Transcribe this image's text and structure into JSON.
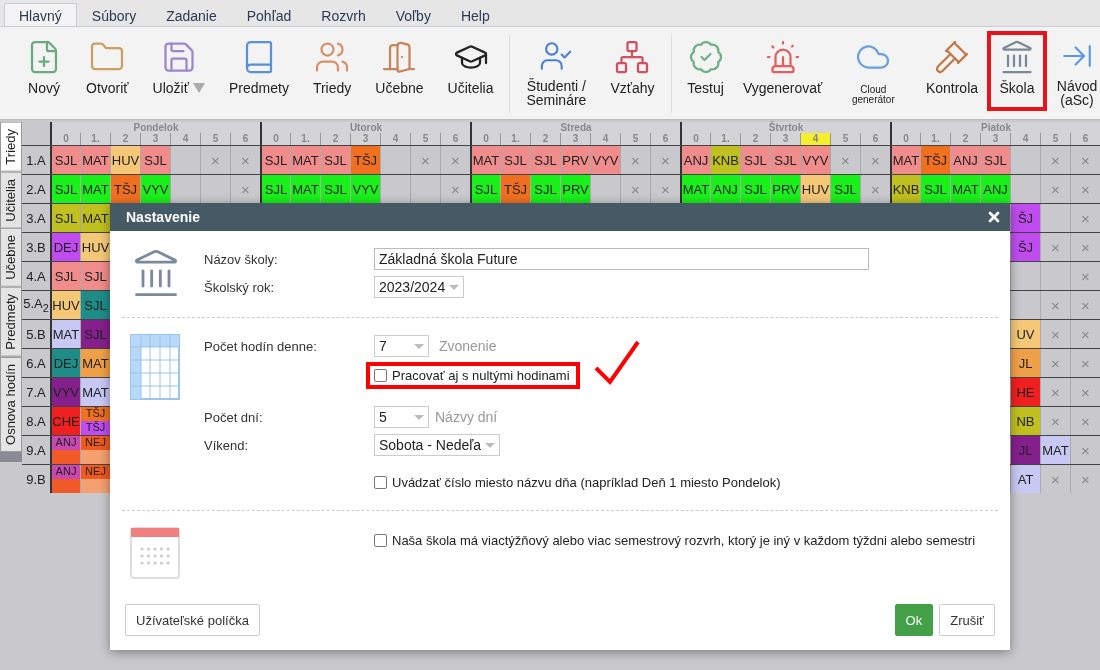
{
  "menu": {
    "tabs": [
      {
        "label": "Hlavný",
        "selected": true
      },
      {
        "label": "Súbory",
        "selected": false
      },
      {
        "label": "Zadanie",
        "selected": false
      },
      {
        "label": "Pohľad",
        "selected": false
      },
      {
        "label": "Rozvrh",
        "selected": false
      },
      {
        "label": "Voľby",
        "selected": false
      },
      {
        "label": "Help",
        "selected": false
      }
    ]
  },
  "toolbar": {
    "groups": [
      {
        "buttons": [
          {
            "label": "Nový",
            "kind": "normal",
            "highlighted": false
          },
          {
            "label": "Otvoriť",
            "kind": "normal",
            "highlighted": false
          },
          {
            "label": "Uložiť",
            "kind": "dropdown",
            "highlighted": false
          },
          {
            "label": "Predmety",
            "kind": "normal",
            "highlighted": false
          },
          {
            "label": "Triedy",
            "kind": "normal",
            "highlighted": false
          },
          {
            "label": "Učebne",
            "kind": "normal",
            "highlighted": false
          },
          {
            "label": "Učitelia",
            "kind": "normal",
            "highlighted": false
          }
        ]
      },
      {
        "buttons": [
          {
            "label": "Študenti /\nSemináre",
            "kind": "normal",
            "highlighted": false
          },
          {
            "label": "Vzťahy",
            "kind": "normal",
            "highlighted": false
          }
        ]
      },
      {
        "buttons": [
          {
            "label": "Testuj",
            "kind": "normal",
            "highlighted": false
          },
          {
            "label": "Vygenerovať",
            "kind": "normal",
            "highlighted": false
          },
          {
            "label": "Cloud generátor",
            "kind": "compact",
            "highlighted": false
          },
          {
            "label": "Kontrola",
            "kind": "normal",
            "highlighted": false
          },
          {
            "label": "Škola",
            "kind": "normal",
            "highlighted": true
          },
          {
            "label": "Návod\n(aSc)",
            "kind": "normal",
            "highlighted": false
          }
        ]
      }
    ]
  },
  "side_tabs": [
    {
      "label": "Triedy",
      "selected": true
    },
    {
      "label": "Učitelia",
      "selected": false
    },
    {
      "label": "Učebne",
      "selected": false
    },
    {
      "label": "Predmety",
      "selected": false
    },
    {
      "label": "Osnova hodín",
      "selected": false
    }
  ],
  "timetable": {
    "days": [
      {
        "name": "Pondelok",
        "periods": [
          {
            "label": "0",
            "highlighted": false
          },
          {
            "label": "1.",
            "highlighted": false
          },
          {
            "label": "2",
            "highlighted": false
          },
          {
            "label": "3",
            "highlighted": false
          },
          {
            "label": "4",
            "highlighted": false
          },
          {
            "label": "5",
            "highlighted": false
          },
          {
            "label": "6",
            "highlighted": false
          }
        ]
      },
      {
        "name": "Utorok",
        "periods": [
          {
            "label": "0",
            "highlighted": false
          },
          {
            "label": "1.",
            "highlighted": false
          },
          {
            "label": "2",
            "highlighted": false
          },
          {
            "label": "3",
            "highlighted": false
          },
          {
            "label": "4",
            "highlighted": false
          },
          {
            "label": "5",
            "highlighted": false
          },
          {
            "label": "6",
            "highlighted": false
          }
        ]
      },
      {
        "name": "Streda",
        "periods": [
          {
            "label": "0",
            "highlighted": false
          },
          {
            "label": "1.",
            "highlighted": false
          },
          {
            "label": "2",
            "highlighted": false
          },
          {
            "label": "3",
            "highlighted": false
          },
          {
            "label": "4",
            "highlighted": false
          },
          {
            "label": "5",
            "highlighted": false
          },
          {
            "label": "6",
            "highlighted": false
          }
        ]
      },
      {
        "name": "Štvrtok",
        "periods": [
          {
            "label": "0",
            "highlighted": false
          },
          {
            "label": "1.",
            "highlighted": false
          },
          {
            "label": "2",
            "highlighted": false
          },
          {
            "label": "3",
            "highlighted": false
          },
          {
            "label": "4",
            "highlighted": true
          },
          {
            "label": "5",
            "highlighted": false
          },
          {
            "label": "6",
            "highlighted": false
          }
        ]
      },
      {
        "name": "Piatok",
        "periods": [
          {
            "label": "0",
            "highlighted": false
          },
          {
            "label": "1.",
            "highlighted": false
          },
          {
            "label": "2",
            "highlighted": false
          },
          {
            "label": "3",
            "highlighted": false
          },
          {
            "label": "4",
            "highlighted": false
          },
          {
            "label": "5",
            "highlighted": false
          },
          {
            "label": "6",
            "highlighted": false
          }
        ]
      }
    ],
    "rows": [
      {
        "name": "1.A",
        "kind": "full",
        "cells": [
          {
            "kind": "lesson",
            "text": "SJL",
            "color": "#f08c8c"
          },
          {
            "kind": "lesson",
            "text": "MAT",
            "color": "#f08c8c"
          },
          {
            "kind": "lesson",
            "text": "HUV",
            "color": "#f5c878"
          },
          {
            "kind": "lesson",
            "text": "SJL",
            "color": "#f08c8c"
          },
          {
            "kind": "empty"
          },
          {
            "kind": "blocked",
            "text": "×"
          },
          {
            "kind": "blocked",
            "text": "×"
          },
          {
            "kind": "lesson",
            "text": "SJL",
            "color": "#f08c8c"
          },
          {
            "kind": "lesson",
            "text": "MAT",
            "color": "#f08c8c"
          },
          {
            "kind": "lesson",
            "text": "SJL",
            "color": "#f08c8c"
          },
          {
            "kind": "lesson",
            "text": "TŠJ",
            "color": "#f07020"
          },
          {
            "kind": "empty"
          },
          {
            "kind": "blocked",
            "text": "×"
          },
          {
            "kind": "blocked",
            "text": "×"
          },
          {
            "kind": "lesson",
            "text": "MAT",
            "color": "#f08c8c"
          },
          {
            "kind": "lesson",
            "text": "SJL",
            "color": "#f08c8c"
          },
          {
            "kind": "lesson",
            "text": "SJL",
            "color": "#f08c8c"
          },
          {
            "kind": "lesson",
            "text": "PRV",
            "color": "#f08c8c"
          },
          {
            "kind": "lesson",
            "text": "VYV",
            "color": "#f08c8c"
          },
          {
            "kind": "blocked",
            "text": "×"
          },
          {
            "kind": "blocked",
            "text": "×"
          },
          {
            "kind": "lesson",
            "text": "ANJ",
            "color": "#f08c8c"
          },
          {
            "kind": "lesson",
            "text": "KNB",
            "color": "#c0c020"
          },
          {
            "kind": "lesson",
            "text": "SJL",
            "color": "#f08c8c"
          },
          {
            "kind": "lesson",
            "text": "SJL",
            "color": "#f08c8c"
          },
          {
            "kind": "lesson",
            "text": "VYV",
            "color": "#f08c8c"
          },
          {
            "kind": "blocked",
            "text": "×"
          },
          {
            "kind": "blocked",
            "text": "×"
          },
          {
            "kind": "lesson",
            "text": "MAT",
            "color": "#f08c8c"
          },
          {
            "kind": "lesson",
            "text": "TŠJ",
            "color": "#f07020"
          },
          {
            "kind": "lesson",
            "text": "ANJ",
            "color": "#f08c8c"
          },
          {
            "kind": "lesson",
            "text": "SJL",
            "color": "#f08c8c"
          },
          {
            "kind": "empty"
          },
          {
            "kind": "blocked",
            "text": "×"
          },
          {
            "kind": "blocked",
            "text": "×"
          }
        ]
      },
      {
        "name": "2.A",
        "kind": "full",
        "cells": [
          {
            "kind": "lesson",
            "text": "SJL",
            "color": "#1af01a"
          },
          {
            "kind": "lesson",
            "text": "MAT",
            "color": "#1af01a"
          },
          {
            "kind": "lesson",
            "text": "TŠJ",
            "color": "#f07020"
          },
          {
            "kind": "lesson",
            "text": "VYV",
            "color": "#1af01a"
          },
          {
            "kind": "empty"
          },
          {
            "kind": "empty"
          },
          {
            "kind": "blocked",
            "text": "×"
          },
          {
            "kind": "lesson",
            "text": "SJL",
            "color": "#1af01a"
          },
          {
            "kind": "lesson",
            "text": "MAT",
            "color": "#1af01a"
          },
          {
            "kind": "lesson",
            "text": "SJL",
            "color": "#1af01a"
          },
          {
            "kind": "lesson",
            "text": "VYV",
            "color": "#1af01a"
          },
          {
            "kind": "empty"
          },
          {
            "kind": "empty"
          },
          {
            "kind": "blocked",
            "text": "×"
          },
          {
            "kind": "lesson",
            "text": "SJL",
            "color": "#1af01a"
          },
          {
            "kind": "lesson",
            "text": "TŠJ",
            "color": "#f07020"
          },
          {
            "kind": "lesson",
            "text": "SJL",
            "color": "#1af01a"
          },
          {
            "kind": "lesson",
            "text": "PRV",
            "color": "#1af01a"
          },
          {
            "kind": "empty"
          },
          {
            "kind": "blocked",
            "text": "×"
          },
          {
            "kind": "blocked",
            "text": "×"
          },
          {
            "kind": "lesson",
            "text": "MAT",
            "color": "#1af01a"
          },
          {
            "kind": "lesson",
            "text": "ANJ",
            "color": "#1af01a"
          },
          {
            "kind": "lesson",
            "text": "SJL",
            "color": "#1af01a"
          },
          {
            "kind": "lesson",
            "text": "PRV",
            "color": "#1af01a"
          },
          {
            "kind": "lesson",
            "text": "HUV",
            "color": "#f5c878"
          },
          {
            "kind": "lesson",
            "text": "SJL",
            "color": "#1af01a"
          },
          {
            "kind": "blocked",
            "text": "×"
          },
          {
            "kind": "lesson",
            "text": "KNB",
            "color": "#c0c020"
          },
          {
            "kind": "lesson",
            "text": "SJL",
            "color": "#1af01a"
          },
          {
            "kind": "lesson",
            "text": "MAT",
            "color": "#1af01a"
          },
          {
            "kind": "lesson",
            "text": "ANJ",
            "color": "#1af01a"
          },
          {
            "kind": "empty"
          },
          {
            "kind": "blocked",
            "text": "×"
          },
          {
            "kind": "blocked",
            "text": "×"
          }
        ]
      },
      {
        "name": "3.A",
        "kind": "covered",
        "left": [
          {
            "kind": "lesson",
            "text": "SJL",
            "color": "#c0c020"
          },
          {
            "kind": "lesson",
            "text": "MAT",
            "color": "#c0c020"
          }
        ],
        "right": [
          {
            "kind": "lesson",
            "text": "ŠJ",
            "color": "#c04cf0"
          },
          {
            "kind": "empty"
          },
          {
            "kind": "blocked",
            "text": "×"
          }
        ]
      },
      {
        "name": "3.B",
        "kind": "covered",
        "left": [
          {
            "kind": "lesson",
            "text": "DEJ",
            "color": "#c04cf0"
          },
          {
            "kind": "lesson",
            "text": "HUV",
            "color": "#f5c878"
          }
        ],
        "right": [
          {
            "kind": "lesson",
            "text": "ŠJ",
            "color": "#c04cf0"
          },
          {
            "kind": "blocked",
            "text": "×"
          },
          {
            "kind": "blocked",
            "text": "×"
          }
        ]
      },
      {
        "name": "4.A",
        "kind": "covered",
        "left": [
          {
            "kind": "lesson",
            "text": "SJL",
            "color": "#f08c8c"
          },
          {
            "kind": "lesson",
            "text": "SJL",
            "color": "#f08c8c"
          }
        ],
        "right": [
          {
            "kind": "empty"
          },
          {
            "kind": "empty"
          },
          {
            "kind": "blocked",
            "text": "×"
          }
        ]
      },
      {
        "name": "5.A$_{2}$",
        "kind": "covered",
        "left": [
          {
            "kind": "lesson",
            "text": "HUV",
            "color": "#f5c878"
          },
          {
            "kind": "lesson",
            "text": "SJL",
            "color": "#208c88"
          }
        ],
        "right": [
          {
            "kind": "empty"
          },
          {
            "kind": "blocked",
            "text": "×"
          },
          {
            "kind": "blocked",
            "text": "×"
          }
        ]
      },
      {
        "name": "5.B",
        "kind": "covered",
        "left": [
          {
            "kind": "lesson",
            "text": "MAT",
            "color": "#c8c8f4"
          },
          {
            "kind": "lesson",
            "text": "SJL",
            "color": "#84208c"
          }
        ],
        "right": [
          {
            "kind": "lesson",
            "text": "UV",
            "color": "#f5c878"
          },
          {
            "kind": "blocked",
            "text": "×"
          },
          {
            "kind": "blocked",
            "text": "×"
          }
        ]
      },
      {
        "name": "6.A",
        "kind": "covered",
        "left": [
          {
            "kind": "lesson",
            "text": "DEJ",
            "color": "#208c88"
          },
          {
            "kind": "lesson",
            "text": "MAT",
            "color": "#f0a048"
          }
        ],
        "right": [
          {
            "kind": "lesson",
            "text": "JL",
            "color": "#f0a048"
          },
          {
            "kind": "blocked",
            "text": "×"
          },
          {
            "kind": "blocked",
            "text": "×"
          }
        ]
      },
      {
        "name": "7.A",
        "kind": "covered",
        "left": [
          {
            "kind": "lesson",
            "text": "VYV",
            "color": "#84208c"
          },
          {
            "kind": "lesson",
            "text": "MAT",
            "color": "#c8c8f4"
          }
        ],
        "right": [
          {
            "kind": "lesson",
            "text": "HE",
            "color": "#f02020"
          },
          {
            "kind": "blocked",
            "text": "×"
          },
          {
            "kind": "blocked",
            "text": "×"
          }
        ]
      },
      {
        "name": "8.A",
        "kind": "covered",
        "left": [
          {
            "kind": "lesson",
            "text": "CHE",
            "color": "#f02020"
          },
          {
            "kind": "split",
            "parts": [
              {
                "text": "TŠJ",
                "color": "#f07020"
              },
              {
                "text": "TŠJ",
                "color": "#c04cf0"
              }
            ]
          }
        ],
        "right": [
          {
            "kind": "lesson",
            "text": "NB",
            "color": "#c0c020"
          },
          {
            "kind": "blocked",
            "text": "×"
          },
          {
            "kind": "blocked",
            "text": "×"
          }
        ]
      },
      {
        "name": "9.A",
        "kind": "covered",
        "left": [
          {
            "kind": "split",
            "parts": [
              {
                "text": "ANJ",
                "color": "#c848b0"
              },
              {
                "color": "#f05a28"
              }
            ]
          },
          {
            "kind": "split",
            "parts": [
              {
                "text": "NEJ",
                "color": "#f05a20"
              },
              {
                "color": "#f4a070"
              }
            ]
          }
        ],
        "right": [
          {
            "kind": "lesson",
            "text": "JL",
            "color": "#84208c"
          },
          {
            "kind": "lesson",
            "text": "MAT",
            "color": "#c8c8f4"
          },
          {
            "kind": "blocked",
            "text": "×"
          }
        ]
      },
      {
        "name": "9.B",
        "kind": "covered",
        "left": [
          {
            "kind": "split",
            "parts": [
              {
                "text": "ANJ",
                "color": "#c848b0"
              },
              {
                "color": "#f05a28"
              }
            ]
          },
          {
            "kind": "split",
            "parts": [
              {
                "text": "NEJ",
                "color": "#f05a20"
              },
              {
                "color": "#f4a070"
              }
            ]
          }
        ],
        "right": [
          {
            "kind": "lesson",
            "text": "AT",
            "color": "#c8c8f4"
          },
          {
            "kind": "blocked",
            "text": "×"
          },
          {
            "kind": "blocked",
            "text": "×"
          }
        ]
      }
    ]
  },
  "dialog": {
    "title": "Nastavenie",
    "school": {
      "name_label": "Názov školy:",
      "name_value": "Základná škola Future",
      "year_label": "Školský rok:",
      "year_value": "2023/2024"
    },
    "schedule": {
      "hours_label": "Počet hodín denne:",
      "hours_value": "7",
      "bells_link": "Zvonenie",
      "zero_hours": {
        "label": "Pracovať aj s nultými hodinami",
        "checked": false,
        "highlighted": true
      },
      "days_label": "Počet dní:",
      "days_value": "5",
      "day_names_link": "Názvy dní",
      "weekend_label": "Víkend:",
      "weekend_value": "Sobota - Nedeľa",
      "day_numbers": {
        "label": "Uvádzať číslo miesto názvu dňa (napríklad Deň 1 miesto Pondelok)",
        "checked": false,
        "highlighted": false
      }
    },
    "terms": {
      "multi_week": {
        "label": "Naša škola má viactýžňový alebo viac semestrový rozvrh, ktorý je iný v každom týždni alebo semestri",
        "checked": false,
        "highlighted": false
      }
    },
    "buttons": {
      "custom_fields": "Užívateľské políčka",
      "ok": "Ok",
      "cancel": "Zrušiť"
    }
  }
}
